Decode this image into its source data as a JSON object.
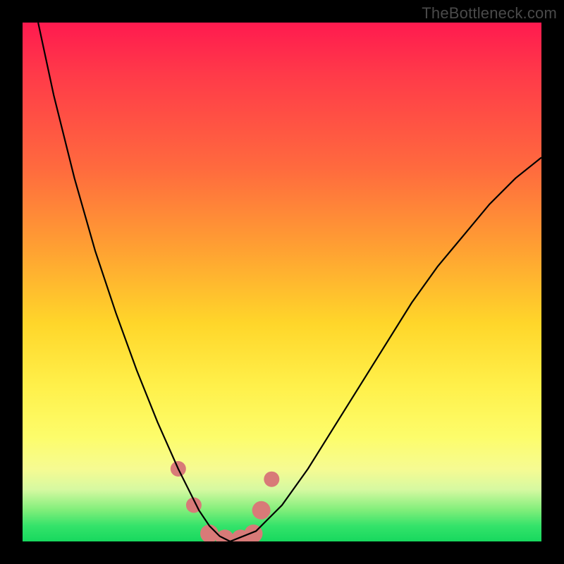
{
  "watermark": "TheBottleneck.com",
  "chart_data": {
    "type": "line",
    "title": "",
    "xlabel": "",
    "ylabel": "",
    "xlim": [
      0,
      100
    ],
    "ylim": [
      0,
      100
    ],
    "series": [
      {
        "name": "bottleneck-curve",
        "x": [
          3,
          6,
          10,
          14,
          18,
          22,
          26,
          30,
          32,
          34,
          36,
          38,
          40,
          45,
          50,
          55,
          60,
          65,
          70,
          75,
          80,
          85,
          90,
          95,
          100
        ],
        "values": [
          100,
          86,
          70,
          56,
          44,
          33,
          23,
          14,
          10,
          6,
          3,
          1,
          0,
          2,
          7,
          14,
          22,
          30,
          38,
          46,
          53,
          59,
          65,
          70,
          74
        ]
      }
    ],
    "highlight": {
      "name": "optimal-zone",
      "color": "#d87a78",
      "points": [
        {
          "x": 30,
          "y": 14,
          "r": 11
        },
        {
          "x": 33,
          "y": 7,
          "r": 11
        },
        {
          "x": 36,
          "y": 1.5,
          "r": 13
        },
        {
          "x": 39,
          "y": 0.5,
          "r": 13
        },
        {
          "x": 42,
          "y": 0.5,
          "r": 13
        },
        {
          "x": 44.5,
          "y": 1.5,
          "r": 13
        },
        {
          "x": 46,
          "y": 6,
          "r": 13
        },
        {
          "x": 48,
          "y": 12,
          "r": 11
        }
      ]
    },
    "background_gradient": {
      "top": "#ff1a4f",
      "mid": "#fff04a",
      "bottom": "#17d85e"
    }
  }
}
